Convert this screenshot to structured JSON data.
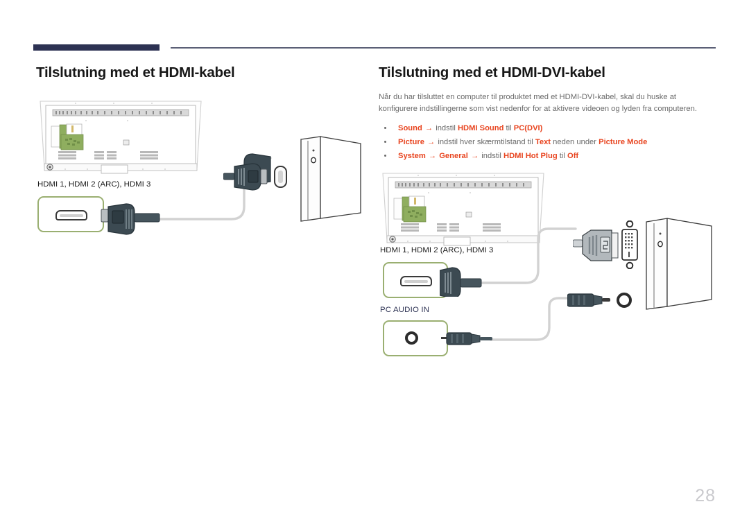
{
  "page": {
    "number": "28",
    "accent_navy": "#2d3253",
    "accent_orange": "#e8441f",
    "accent_green": "#9aaf71"
  },
  "left_column": {
    "title": "Tilslutning med et HDMI-kabel",
    "port_label": "HDMI 1, HDMI 2 (ARC), HDMI 3"
  },
  "right_column": {
    "title": "Tilslutning med et HDMI-DVI-kabel",
    "body": "Når du har tilsluttet en computer til produktet med et HDMI-DVI-kabel, skal du huske at konfigurere indstillingerne som vist nedenfor for at aktivere videoen og lyden fra computeren.",
    "bullets": [
      {
        "parts": [
          {
            "text": "Sound",
            "style": "em"
          },
          {
            "text": " → ",
            "style": "arr"
          },
          {
            "text": "indstil ",
            "style": "plain"
          },
          {
            "text": "HDMI Sound",
            "style": "em"
          },
          {
            "text": " til ",
            "style": "plain"
          },
          {
            "text": "PC(DVI)",
            "style": "em"
          }
        ]
      },
      {
        "parts": [
          {
            "text": "Picture",
            "style": "em"
          },
          {
            "text": " → ",
            "style": "arr"
          },
          {
            "text": "indstil hver skærmtilstand til ",
            "style": "plain"
          },
          {
            "text": "Text",
            "style": "em"
          },
          {
            "text": " neden under ",
            "style": "plain"
          },
          {
            "text": "Picture Mode",
            "style": "em"
          }
        ]
      },
      {
        "parts": [
          {
            "text": "System",
            "style": "em"
          },
          {
            "text": " → ",
            "style": "arr"
          },
          {
            "text": "General",
            "style": "em"
          },
          {
            "text": " → ",
            "style": "arr"
          },
          {
            "text": "indstil ",
            "style": "plain"
          },
          {
            "text": "HDMI Hot Plug",
            "style": "em"
          },
          {
            "text": " til ",
            "style": "plain"
          },
          {
            "text": "Off",
            "style": "em"
          }
        ]
      }
    ],
    "hdmi_port_label": "HDMI 1, HDMI 2 (ARC), HDMI 3",
    "audio_port_label": "PC AUDIO IN"
  }
}
